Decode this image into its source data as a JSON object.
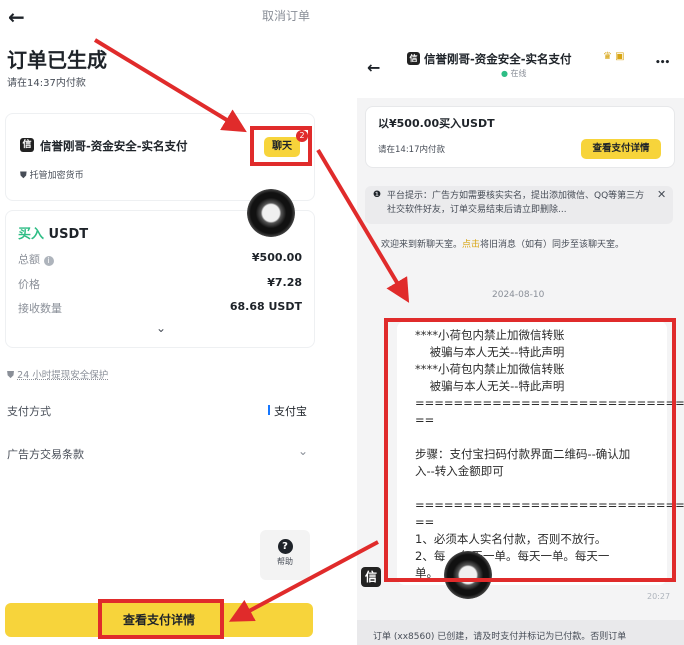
{
  "left": {
    "back_icon": "←",
    "cancel_label": "取消订单",
    "title": "订单已生成",
    "subtitle": "请在14:37内付款",
    "merchant_logo": "信",
    "merchant_name": "信誉刚哥-资金安全-实名支付",
    "chat_label": "聊天",
    "chat_badge": "2",
    "escrow_label": "托管加密货币",
    "buy_word": "买入",
    "asset": "USDT",
    "rows": [
      {
        "label": "总额",
        "value": "¥500.00"
      },
      {
        "label": "价格",
        "value": "¥7.28"
      },
      {
        "label": "接收数量",
        "value": "68.68 USDT"
      }
    ],
    "protection_label": "24 小时提现安全保护",
    "payment_label": "支付方式",
    "payment_value": "支付宝",
    "terms_label": "广告方交易条款",
    "help_label": "帮助",
    "pay_button": "查看支付详情"
  },
  "right": {
    "back_icon": "←",
    "merchant_logo": "信",
    "merchant_name": "信誉刚哥-资金安全-实名支付",
    "status": "在线",
    "more_icon": "•••",
    "order_title": "以¥500.00买入USDT",
    "order_deadline": "请在14:17内付款",
    "order_button": "查看支付详情",
    "notice": "平台提示：广告方如需要核实实名，提出添加微信、QQ等第三方社交软件好友，订单交易结束后请立即删除...",
    "welcome_prefix": "欢迎来到新聊天室。",
    "welcome_link": "点击",
    "welcome_suffix": "将旧消息（如有）同步至该聊天室。",
    "date": "2024-08-10",
    "message_lines": [
      "****小荷包内禁止加微信转账",
      "    被骗与本人无关--特此声明",
      "****小荷包内禁止加微信转账",
      "    被骗与本人无关--特此声明",
      "=================================",
      "==",
      "",
      "步骤：支付宝扫码付款界面二维码--确认加",
      "入--转入金额即可",
      "",
      "=================================",
      "==",
      "1、必须本人实名付款，否则不放行。",
      "2、每    每天一单。每天一单。每天一",
      "单。"
    ],
    "time": "20:27",
    "footer": "订单 (xx8560) 已创建，请及时支付并标记为已付款。否则订单"
  },
  "colors": {
    "accent": "#f7d43b",
    "annotation": "#e02b2b",
    "buy_green": "#2ebd85"
  }
}
